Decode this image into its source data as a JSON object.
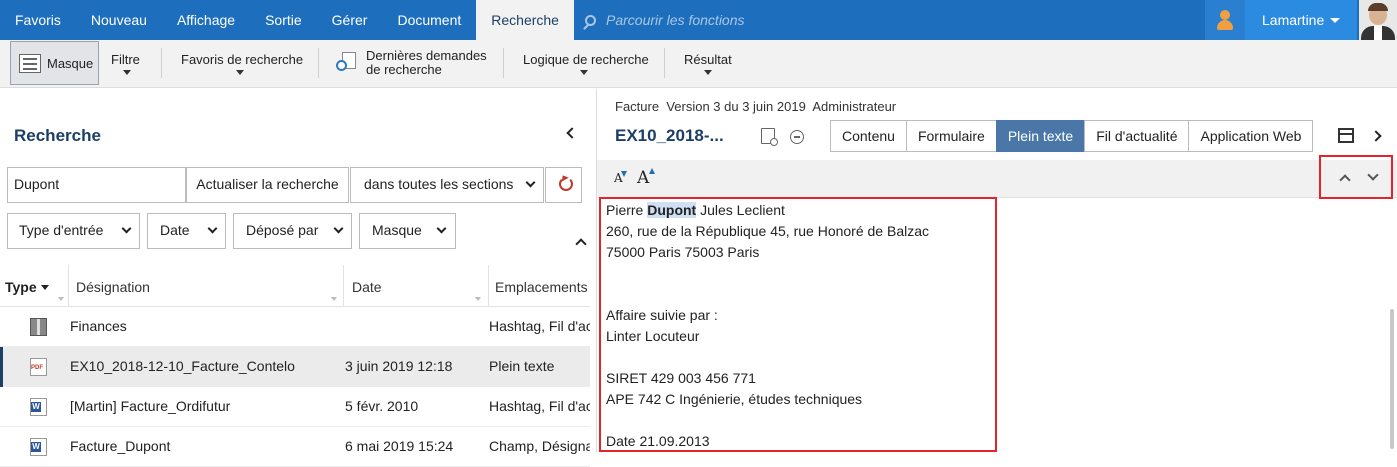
{
  "topnav": {
    "items": [
      "Favoris",
      "Nouveau",
      "Affichage",
      "Sortie",
      "Gérer",
      "Document",
      "Recherche"
    ],
    "active_index": 6,
    "search_placeholder": "Parcourir les fonctions",
    "user_name": "Lamartine"
  },
  "ribbon": {
    "masque": "Masque",
    "filtre": "Filtre",
    "favoris_recherche": "Favoris de recherche",
    "dernieres_line1": "Dernières demandes",
    "dernieres_line2": "de recherche",
    "logique": "Logique de recherche",
    "resultat": "Résultat"
  },
  "search_panel": {
    "title": "Recherche",
    "query": "Dupont",
    "refresh_button": "Actualiser la recherche",
    "scope": "dans toutes les sections",
    "filters": [
      "Type d'entrée",
      "Date",
      "Déposé par",
      "Masque"
    ],
    "columns": [
      "Type",
      "Désignation",
      "Date",
      "Emplacements"
    ],
    "rows": [
      {
        "icon": "folder-icon",
        "name": "Finances",
        "date": "",
        "location": "Hashtag, Fil d'ac"
      },
      {
        "icon": "pdf-icon",
        "name": "EX10_2018-12-10_Facture_Contelo",
        "date": "3 juin 2019 12:18",
        "location": "Plein texte"
      },
      {
        "icon": "word-icon",
        "name": "[Martin] Facture_Ordifutur",
        "date": "5 févr. 2010",
        "location": "Hashtag, Fil d'ac"
      },
      {
        "icon": "word-icon",
        "name": "Facture_Dupont",
        "date": "6 mai 2019 15:24",
        "location": "Champ, Désignat"
      }
    ],
    "selected_row": 1
  },
  "document": {
    "meta_type": "Facture",
    "meta_version": "Version 3 du 3 juin 2019",
    "meta_author": "Administrateur",
    "title": "EX10_2018-...",
    "tabs": [
      "Contenu",
      "Formulaire",
      "Plein texte",
      "Fil d'actualité",
      "Application Web"
    ],
    "active_tab": 2,
    "fulltext": {
      "line1_pre": "Pierre ",
      "line1_hit": "Dupont",
      "line1_post": " Jules Leclient",
      "line2": "260, rue de la République 45, rue Honoré de Balzac",
      "line3": "75000 Paris 75003 Paris",
      "line4": "Affaire suivie par :",
      "line5": "Linter Locuteur",
      "line6": "SIRET 429 003 456 771",
      "line7": "APE 742 C Ingénierie, études techniques",
      "line8": "Date 21.09.2013"
    }
  },
  "colors": {
    "topbar": "#1d6fbe",
    "accent_dark": "#1d3f66",
    "active_tab": "#4a77a8",
    "highlight_box": "#e3242b"
  }
}
